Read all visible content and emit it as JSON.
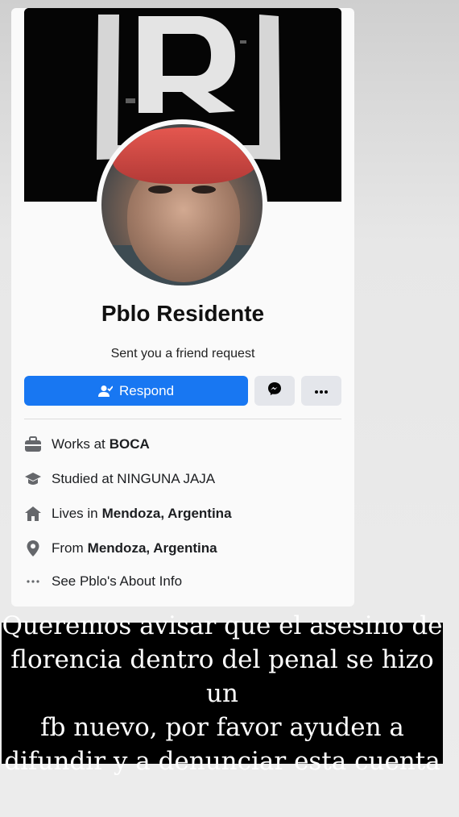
{
  "profile": {
    "name": "Pblo Residente",
    "subtitle": "Sent you a friend request"
  },
  "actions": {
    "respond_label": "Respond",
    "messenger_icon": "messenger-icon",
    "more_icon": "more-icon",
    "accent_color": "#1877f2"
  },
  "info": {
    "work_prefix": "Works at",
    "work_place": "BOCA",
    "study_text": "Studied at NINGUNA JAJA",
    "lives_prefix": "Lives in",
    "lives_place": "Mendoza, Argentina",
    "from_prefix": "From",
    "from_place": "Mendoza, Argentina",
    "about_text": "See Pblo's About Info"
  },
  "caption": {
    "lines": [
      "Queremos avisar que el asesino de",
      "florencia dentro del penal se hizo un",
      "fb nuevo, por favor ayuden a",
      "difundir y a denunciar esta cuenta"
    ]
  }
}
